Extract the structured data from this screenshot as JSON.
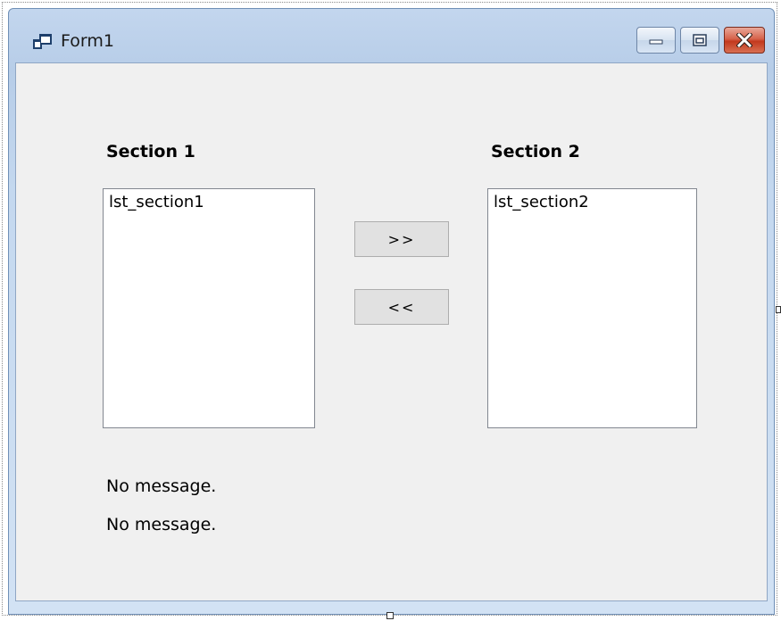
{
  "window": {
    "title": "Form1",
    "icon": "form-window-icon",
    "controls": {
      "minimize_icon": "minimize-icon",
      "maximize_icon": "maximize-icon",
      "close_icon": "close-icon"
    }
  },
  "section1": {
    "heading": "Section 1",
    "listbox_name": "lst_section1"
  },
  "section2": {
    "heading": "Section 2",
    "listbox_name": "lst_section2"
  },
  "buttons": {
    "move_right_label": ">>",
    "move_left_label": "<<"
  },
  "messages": [
    "No message.",
    "No message."
  ],
  "colors": {
    "client_background": "#f0f0f0",
    "close_button": "#c9462c",
    "titlebar": "#c3d6ee"
  }
}
